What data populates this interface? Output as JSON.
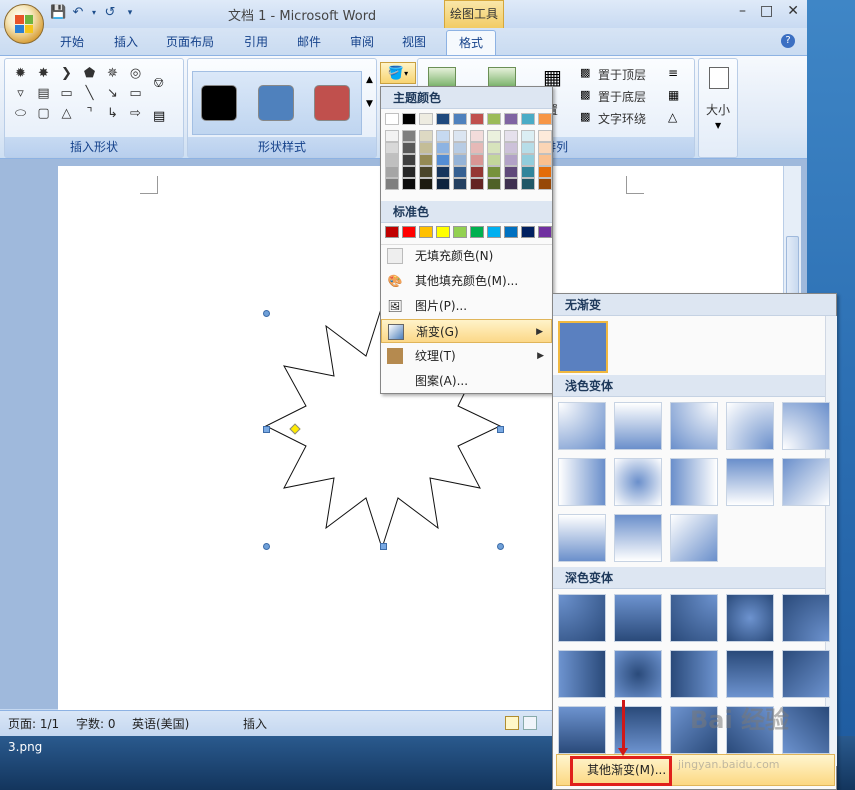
{
  "app": {
    "title": "文档 1 - Microsoft Word",
    "contextual_tab_group": "绘图工具",
    "tabs": [
      "开始",
      "插入",
      "页面布局",
      "引用",
      "邮件",
      "审阅",
      "视图",
      "格式"
    ],
    "active_tab": "格式",
    "help": "?"
  },
  "ribbon": {
    "group_shapes": "插入形状",
    "group_styles": "形状样式",
    "group_arrange": "排列",
    "arrange_items": [
      "置于顶层",
      "置于底层",
      "文字环绕"
    ],
    "arrange_partial": "置",
    "size_label": "大小",
    "style_colors": [
      "#000000",
      "#4f81bd",
      "#c0504d"
    ]
  },
  "fill_menu": {
    "theme_header": "主题颜色",
    "standard_header": "标准色",
    "theme_colors": [
      [
        "#ffffff",
        "#f2f2f2",
        "#d8d8d8",
        "#bfbfbf",
        "#a5a5a5",
        "#7f7f7f"
      ],
      [
        "#000000",
        "#7f7f7f",
        "#595959",
        "#3f3f3f",
        "#262626",
        "#0c0c0c"
      ],
      [
        "#eeece1",
        "#ddd9c3",
        "#c4bd97",
        "#948a54",
        "#4a452a",
        "#1d1b10"
      ],
      [
        "#1f497d",
        "#c6d9f0",
        "#8db3e2",
        "#548dd4",
        "#17365d",
        "#0f243e"
      ],
      [
        "#4f81bd",
        "#dbe5f1",
        "#b8cce4",
        "#95b3d7",
        "#366092",
        "#244061"
      ],
      [
        "#c0504d",
        "#f2dcdb",
        "#e5b9b7",
        "#d99694",
        "#953734",
        "#632423"
      ],
      [
        "#9bbb59",
        "#ebf1dd",
        "#d7e3bc",
        "#c3d69b",
        "#76923c",
        "#4f6128"
      ],
      [
        "#8064a2",
        "#e5e0ec",
        "#ccc1d9",
        "#b2a2c7",
        "#5f497a",
        "#3f3151"
      ],
      [
        "#4bacc6",
        "#dbeef3",
        "#b7dde8",
        "#92cddc",
        "#31859b",
        "#205867"
      ],
      [
        "#f79646",
        "#fdeada",
        "#fbd5b5",
        "#fac08f",
        "#e36c09",
        "#974806"
      ]
    ],
    "standard_colors": [
      "#c00000",
      "#ff0000",
      "#ffc000",
      "#ffff00",
      "#92d050",
      "#00b050",
      "#00b0f0",
      "#0070c0",
      "#002060",
      "#7030a0"
    ],
    "items": [
      {
        "label": "无填充颜色(N)",
        "icon": "no-fill-icon"
      },
      {
        "label": "其他填充颜色(M)...",
        "icon": "palette-icon"
      },
      {
        "label": "图片(P)...",
        "icon": "picture-icon"
      },
      {
        "label": "渐变(G)",
        "icon": "gradient-icon"
      },
      {
        "label": "纹理(T)",
        "icon": "texture-icon"
      },
      {
        "label": "图案(A)...",
        "icon": "pattern-icon"
      }
    ]
  },
  "gradient_menu": {
    "no_gradient": "无渐变",
    "light_variants": "浅色变体",
    "dark_variants": "深色变体",
    "more_gradients": "其他渐变(M)..."
  },
  "status": {
    "page": "页面: 1/1",
    "words": "字数: 0",
    "language": "英语(美国)",
    "mode": "插入"
  },
  "taskbar": {
    "filename": "3.png"
  },
  "watermark": {
    "brand": "Bai 经验",
    "url": "jingyan.baidu.com"
  }
}
